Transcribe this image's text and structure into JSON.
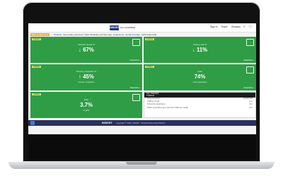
{
  "header": {
    "logo_mark": "INSIGHT",
    "logo_text": "GO LEARNING",
    "nav": [
      "Sign in",
      "Share",
      "Glossary"
    ],
    "icons": [
      "search-icon",
      "info-icon"
    ]
  },
  "breadcrumb": {
    "badge": "Back to dashboard",
    "location": "Thailand",
    "path": "Secondary personal: Child, Disability and Sex Age",
    "suffix": "Analysis at",
    "region": "Global Average",
    "tail": "(with data total)"
  },
  "cards": [
    {
      "tag": "Indicator",
      "icon": "chart-icon",
      "label": "Indicator people %",
      "value": "↓ 67%",
      "note": "",
      "link": "Read More ›"
    },
    {
      "tag": "Indicator",
      "icon": "school-icon",
      "label": "Literacy rate %",
      "value": "↓ 11%",
      "note": "",
      "link": "Read More ›"
    },
    {
      "tag": "Indicator",
      "icon": "",
      "label": "Primary completion %",
      "value": "↑ 45%",
      "note": "primary completion",
      "link": "Read More ›"
    },
    {
      "tag": "Indicator",
      "icon": "learning-icon",
      "label": "Adult",
      "value": "74%",
      "note": "of the population",
      "link": "Read More ›"
    },
    {
      "tag": "Indicator",
      "icon": "money-icon",
      "label": "Rate",
      "value": "3.7%",
      "note": "of GDP",
      "link": "Read More ›"
    }
  ],
  "info": {
    "head1": "Key Statistics",
    "head2": "Thailand",
    "rows": [
      {
        "k": "Total population",
        "v": "69,800,000"
      },
      {
        "k": "Children (0-14)",
        "v": "11.2"
      },
      {
        "k": "School life expectancy",
        "v": "15.1"
      },
      {
        "k": "Public expenditure per pupil (% of GDP per capita)",
        "v": "12.3"
      }
    ]
  },
  "footer": {
    "logo": "INSIGHT",
    "copy": "Copyright © 2022 UNICEF - Global Partnership Platform"
  }
}
